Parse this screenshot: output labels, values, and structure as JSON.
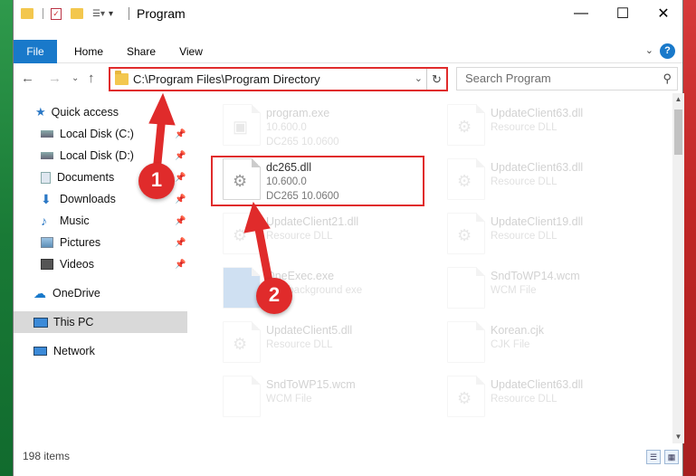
{
  "window": {
    "title": "Program",
    "minimize_glyph": "—",
    "maximize_glyph": "☐",
    "close_glyph": "✕"
  },
  "ribbon": {
    "tabs": [
      {
        "label": "File",
        "active": true
      },
      {
        "label": "Home"
      },
      {
        "label": "Share"
      },
      {
        "label": "View"
      }
    ],
    "help": "?"
  },
  "nav": {
    "address": "C:\\Program Files\\Program Directory",
    "search_placeholder": "Search Program"
  },
  "sidebar": {
    "items": [
      {
        "label": "Quick access",
        "icon": "star-icon",
        "pinned": false
      },
      {
        "label": "Local Disk (C:)",
        "icon": "drive-icon",
        "pinned": true
      },
      {
        "label": "Local Disk (D:)",
        "icon": "drive-icon",
        "pinned": true
      },
      {
        "label": "Documents",
        "icon": "document-icon",
        "pinned": true
      },
      {
        "label": "Downloads",
        "icon": "download-icon",
        "pinned": true
      },
      {
        "label": "Music",
        "icon": "music-icon",
        "pinned": true
      },
      {
        "label": "Pictures",
        "icon": "picture-icon",
        "pinned": true
      },
      {
        "label": "Videos",
        "icon": "video-icon",
        "pinned": true
      },
      {
        "label": "OneDrive",
        "icon": "cloud-icon",
        "pinned": false
      },
      {
        "label": "This PC",
        "icon": "computer-icon",
        "pinned": false,
        "selected": true
      },
      {
        "label": "Network",
        "icon": "network-icon",
        "pinned": false
      }
    ]
  },
  "files": [
    {
      "name": "program.exe",
      "line1": "10.600.0",
      "line2": "DC265 10.0600",
      "faded": true
    },
    {
      "name": "UpdateClient63.dll",
      "line1": "Resource DLL",
      "line2": "",
      "faded": true
    },
    {
      "name": "dc265.dll",
      "line1": "10.600.0",
      "line2": "DC265 10.0600",
      "faded": false
    },
    {
      "name": "UpdateClient63.dll",
      "line1": "Resource DLL",
      "line2": "",
      "faded": true
    },
    {
      "name": "UpdateClient21.dll",
      "line1": "Resource DLL",
      "line2": "",
      "faded": true
    },
    {
      "name": "UpdateClient19.dll",
      "line1": "Resource DLL",
      "line2": "",
      "faded": true
    },
    {
      "name": "OneExec.exe",
      "line1": "Run background exe",
      "line2": "",
      "faded": true
    },
    {
      "name": "SndToWP14.wcm",
      "line1": "WCM File",
      "line2": "",
      "faded": true
    },
    {
      "name": "UpdateClient5.dll",
      "line1": "Resource DLL",
      "line2": "",
      "faded": true
    },
    {
      "name": "Korean.cjk",
      "line1": "CJK File",
      "line2": "",
      "faded": true
    },
    {
      "name": "SndToWP15.wcm",
      "line1": "WCM File",
      "line2": "",
      "faded": true
    },
    {
      "name": "UpdateClient63.dll",
      "line1": "Resource DLL",
      "line2": "",
      "faded": true
    }
  ],
  "status": {
    "item_count": "198 items"
  },
  "annotations": {
    "badge1": "1",
    "badge2": "2",
    "color": "#e02b2b"
  }
}
